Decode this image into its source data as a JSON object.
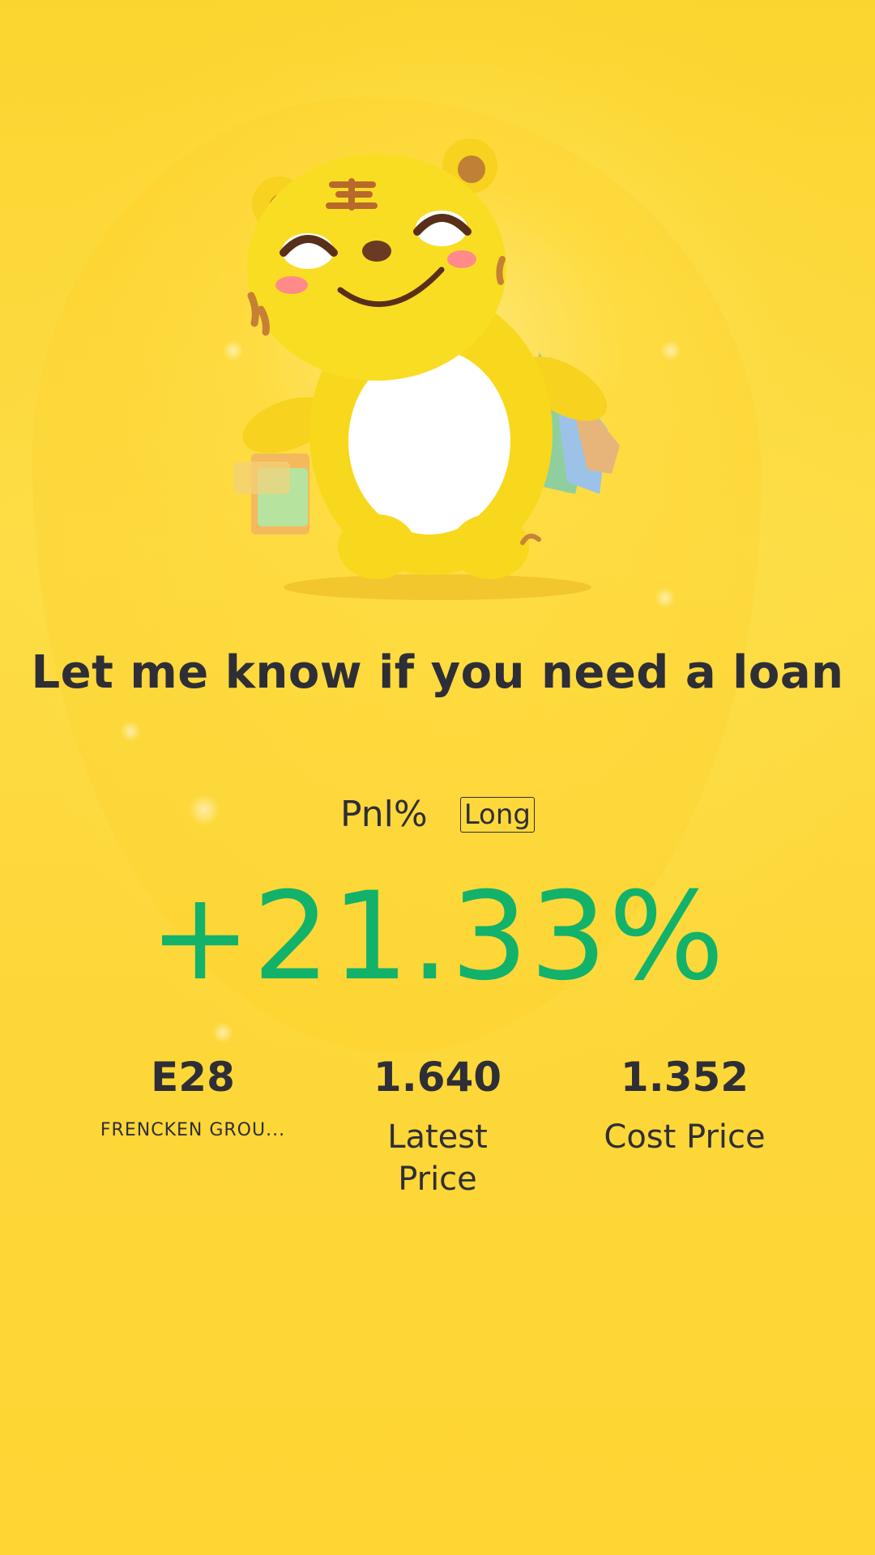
{
  "card": {
    "headline": "Let me know if you need a loan",
    "pnl_label": "Pnl%",
    "direction": "Long",
    "pnl_value": "+21.33%",
    "pnl_color": "#12b26a",
    "background_color": "#fdd735",
    "mascot_icon": "tiger-mascot-with-shopping-bags"
  },
  "stats": [
    {
      "value": "E28",
      "label": "FRENCKEN GROU..."
    },
    {
      "value": "1.640",
      "label": "Latest Price"
    },
    {
      "value": "1.352",
      "label": "Cost Price"
    }
  ]
}
